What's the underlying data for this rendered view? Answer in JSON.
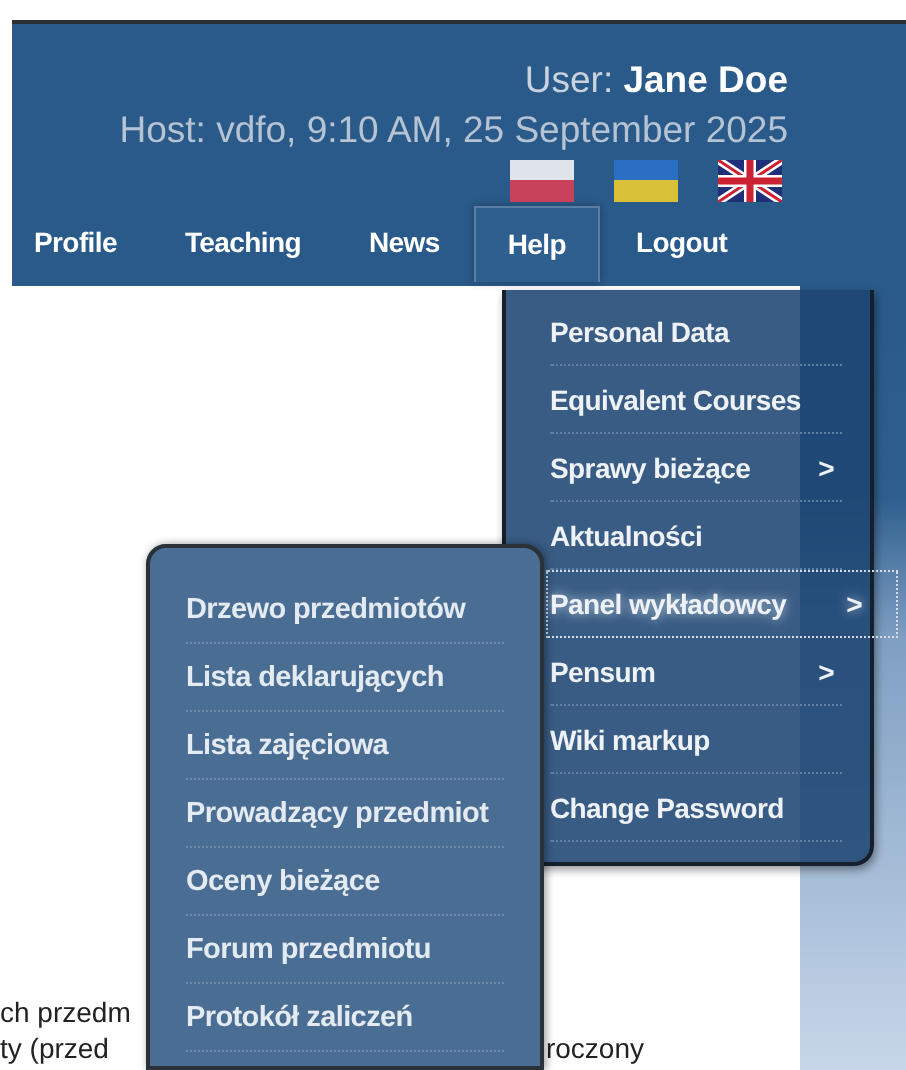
{
  "header": {
    "user_label": "User:",
    "user_name": "Jane Doe",
    "host_line": "Host: vdfo, 9:10 AM, 25 September 2025",
    "languages": [
      {
        "kind": "pl"
      },
      {
        "kind": "ua"
      },
      {
        "kind": "gb"
      }
    ]
  },
  "nav": [
    {
      "label": "Profile",
      "selected": false
    },
    {
      "label": "Teaching",
      "selected": false
    },
    {
      "label": "News",
      "selected": false
    },
    {
      "label": "Help",
      "selected": true
    },
    {
      "label": "Logout",
      "selected": false
    }
  ],
  "menu": [
    {
      "label": "Personal Data",
      "selected": false
    },
    {
      "label": "Equivalent Courses",
      "selected": false
    },
    {
      "label": "Sprawy bieżące",
      "arrow": ">",
      "selected": false
    },
    {
      "label": "Aktualności",
      "selected": false
    },
    {
      "label": "Panel wykładowcy",
      "arrow": ">",
      "selected": true
    },
    {
      "label": "Pensum",
      "arrow": ">",
      "selected": false
    },
    {
      "label": "Wiki markup",
      "selected": false
    },
    {
      "label": "Change Password",
      "selected": false
    }
  ],
  "submenu": [
    {
      "label": "Drzewo przedmiotów"
    },
    {
      "label": "Lista deklarujących"
    },
    {
      "label": "Lista zajęciowa"
    },
    {
      "label": "Prowadzący przedmiot"
    },
    {
      "label": "Oceny bieżące"
    },
    {
      "label": "Forum przedmiotu"
    },
    {
      "label": "Protokół zaliczeń"
    }
  ],
  "content": [
    {
      "left": "ch przedm"
    },
    {
      "left": "ty (przed",
      "right": "roczony"
    }
  ]
}
